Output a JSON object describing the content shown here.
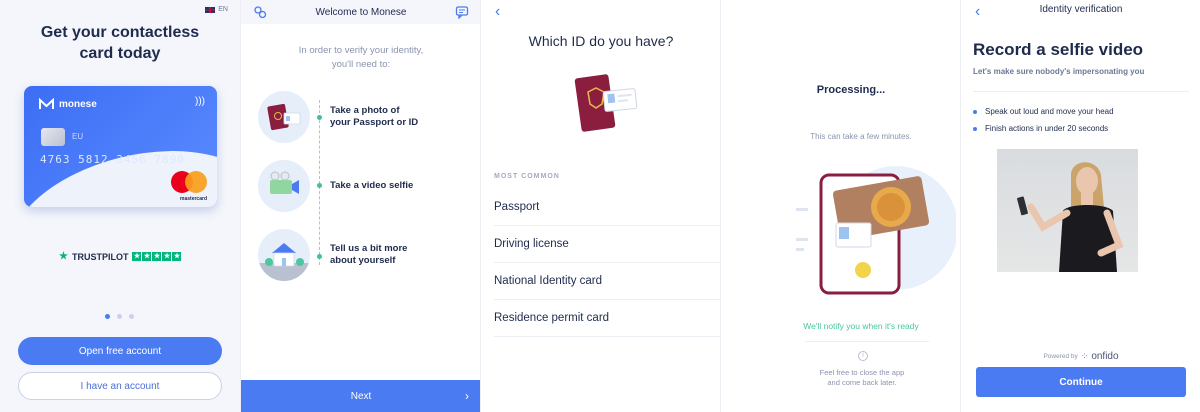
{
  "screen1": {
    "language": "EN",
    "headline": "Get your contactless card today",
    "card": {
      "brand": "monese",
      "region": "EU",
      "number": "4763 5812 3456 7890",
      "network": "mastercard"
    },
    "trustpilot": "TRUSTPILOT",
    "pager": {
      "total": 3,
      "active": 1
    },
    "open_account": "Open free account",
    "have_account": "I have an account"
  },
  "screen2": {
    "title": "Welcome to Monese",
    "intro_line1": "In order to verify your identity,",
    "intro_line2": "you'll need to:",
    "steps": [
      {
        "line1": "Take a photo of",
        "line2": "your Passport or ID"
      },
      {
        "line1": "Take a video selfie",
        "line2": ""
      },
      {
        "line1": "Tell us a bit more",
        "line2": "about yourself"
      }
    ],
    "next": "Next"
  },
  "screen3": {
    "question": "Which ID do you have?",
    "section": "MOST COMMON",
    "options": [
      "Passport",
      "Driving license",
      "National Identity card",
      "Residence permit card"
    ]
  },
  "screen4": {
    "processing": "Processing...",
    "subtitle": "This can take a few minutes.",
    "notify": "We'll notify you when it's ready",
    "info": "i",
    "free_line1": "Feel free to close the app",
    "free_line2": "and come back later."
  },
  "screen5": {
    "title": "Identity verification",
    "heading": "Record a selfie video",
    "subheading": "Let's make sure nobody's impersonating you",
    "bullets": [
      "Speak out loud and move your head",
      "Finish actions in under 20 seconds"
    ],
    "powered_by": "Powered by",
    "provider": "onfido",
    "continue": "Continue"
  },
  "colors": {
    "accent": "#4a7bf2",
    "navy": "#1f2b4d",
    "success": "#4cc79e",
    "passport": "#8b1e3f"
  }
}
